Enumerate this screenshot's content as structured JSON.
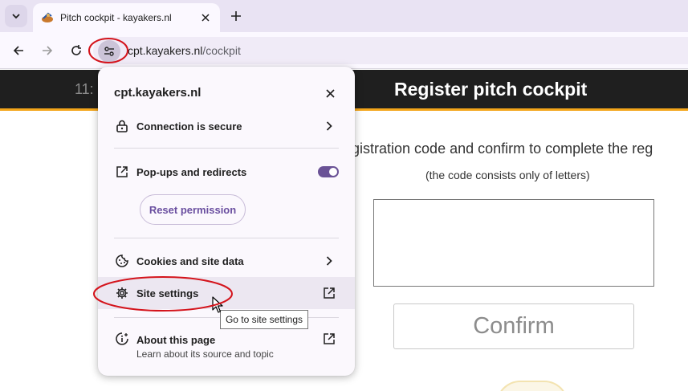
{
  "browser": {
    "tab_title": "Pitch cockpit - kayakers.nl",
    "url_domain": "cpt.kayakers.nl",
    "url_path": "/cockpit",
    "icons": [
      "tab-search-icon",
      "favicon",
      "close-icon",
      "plus-icon",
      "back-arrow-icon",
      "forward-arrow-icon",
      "reload-icon",
      "tune-icon"
    ]
  },
  "page": {
    "clock": "11:",
    "title": "Register pitch cockpit",
    "instruction": "egistration code and confirm to complete the reg",
    "hint": "(the code consists only of letters)",
    "code_value": "",
    "confirm_label": "Confirm",
    "colors": {
      "header_bg": "#1f1f1f",
      "accent": "#f3a51a"
    }
  },
  "popup": {
    "domain": "cpt.kayakers.nl",
    "connection_label": "Connection is secure",
    "popups_label": "Pop-ups and redirects",
    "popups_enabled": true,
    "reset_label": "Reset permission",
    "cookies_label": "Cookies and site data",
    "site_settings_label": "Site settings",
    "about_label": "About this page",
    "about_sub": "Learn about its source and topic",
    "toggle_color": "#6a5296"
  },
  "tooltip": {
    "text": "Go to site settings"
  },
  "annotations": {
    "circle_color": "#d4141c"
  }
}
